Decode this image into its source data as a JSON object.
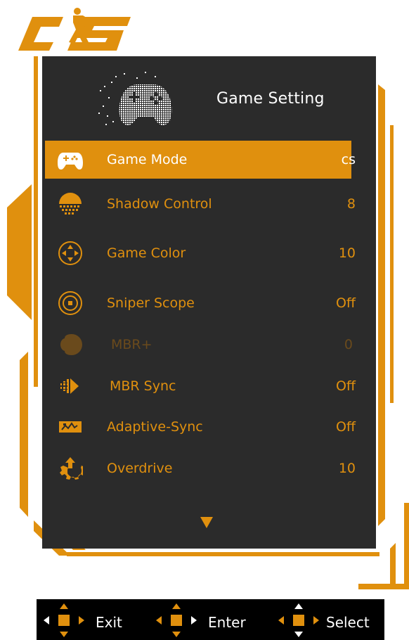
{
  "logo": {
    "text": "CS"
  },
  "header": {
    "title": "Game Setting",
    "icon": "gamepad-icon"
  },
  "menu": {
    "items": [
      {
        "label": "Game Mode",
        "value": "cs",
        "icon": "gamepad-icon",
        "state": "selected"
      },
      {
        "label": "Shadow Control",
        "value": "8",
        "icon": "shadow-icon",
        "state": "normal"
      },
      {
        "label": "Game Color",
        "value": "10",
        "icon": "color-dpad-icon",
        "state": "normal"
      },
      {
        "label": "Sniper Scope",
        "value": "Off",
        "icon": "scope-icon",
        "state": "normal"
      },
      {
        "label": "MBR+",
        "value": "0",
        "icon": "mbr-plus-icon",
        "state": "disabled"
      },
      {
        "label": "MBR Sync",
        "value": "Off",
        "icon": "mbr-sync-icon",
        "state": "normal"
      },
      {
        "label": "Adaptive-Sync",
        "value": "Off",
        "icon": "adaptive-sync-icon",
        "state": "normal"
      },
      {
        "label": "Overdrive",
        "value": "10",
        "icon": "overdrive-icon",
        "state": "normal"
      }
    ],
    "more_indicator": "chevron-down-icon"
  },
  "nav": {
    "exit_label": "Exit",
    "enter_label": "Enter",
    "select_label": "Select"
  },
  "colors": {
    "accent": "#e0900e",
    "panel": "#2b2b2b",
    "disabled": "#6a4a1c",
    "text": "#ffffff"
  }
}
